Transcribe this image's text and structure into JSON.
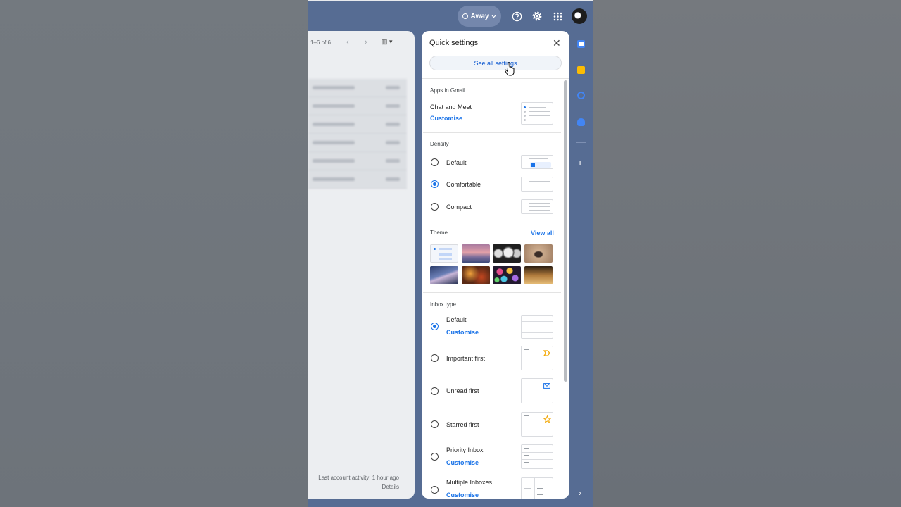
{
  "topbar": {
    "status_label": "Away",
    "icons": [
      "help-icon",
      "gear-icon",
      "apps-grid-icon",
      "avatar"
    ]
  },
  "mail": {
    "pagination": "1–6 of 6",
    "row_count": 6,
    "activity_line": "Last account activity: 1 hour ago",
    "details_link": "Details"
  },
  "quick_settings": {
    "title": "Quick settings",
    "see_all_label": "See all settings",
    "apps_section": {
      "label": "Apps in Gmail",
      "item_label": "Chat and Meet",
      "customise_label": "Customise"
    },
    "density": {
      "label": "Density",
      "options": [
        {
          "label": "Default",
          "selected": false
        },
        {
          "label": "Comfortable",
          "selected": true
        },
        {
          "label": "Compact",
          "selected": false
        }
      ]
    },
    "theme": {
      "label": "Theme",
      "view_all_label": "View all",
      "thumbnails": [
        "default-theme",
        "pink-sky-theme",
        "metal-spheres-theme",
        "pebble-theme",
        "storm-lightning-theme",
        "autumn-leaves-theme",
        "bokeh-lights-theme",
        "chess-theme"
      ]
    },
    "inbox_type": {
      "label": "Inbox type",
      "options": [
        {
          "label": "Default",
          "selected": true,
          "customise": "Customise"
        },
        {
          "label": "Important first",
          "selected": false
        },
        {
          "label": "Unread first",
          "selected": false
        },
        {
          "label": "Starred first",
          "selected": false
        },
        {
          "label": "Priority Inbox",
          "selected": false,
          "customise": "Customise"
        },
        {
          "label": "Multiple Inboxes",
          "selected": false,
          "customise": "Customise"
        }
      ]
    }
  },
  "side_rail": {
    "apps": [
      "calendar-icon",
      "keep-icon",
      "tasks-icon",
      "contacts-icon"
    ],
    "add_label": "+",
    "expand_icon": "chevron-right-icon"
  },
  "colors": {
    "accent": "#1a73e8",
    "gmail_header": "#566c93",
    "panel_background": "#ffffff"
  }
}
